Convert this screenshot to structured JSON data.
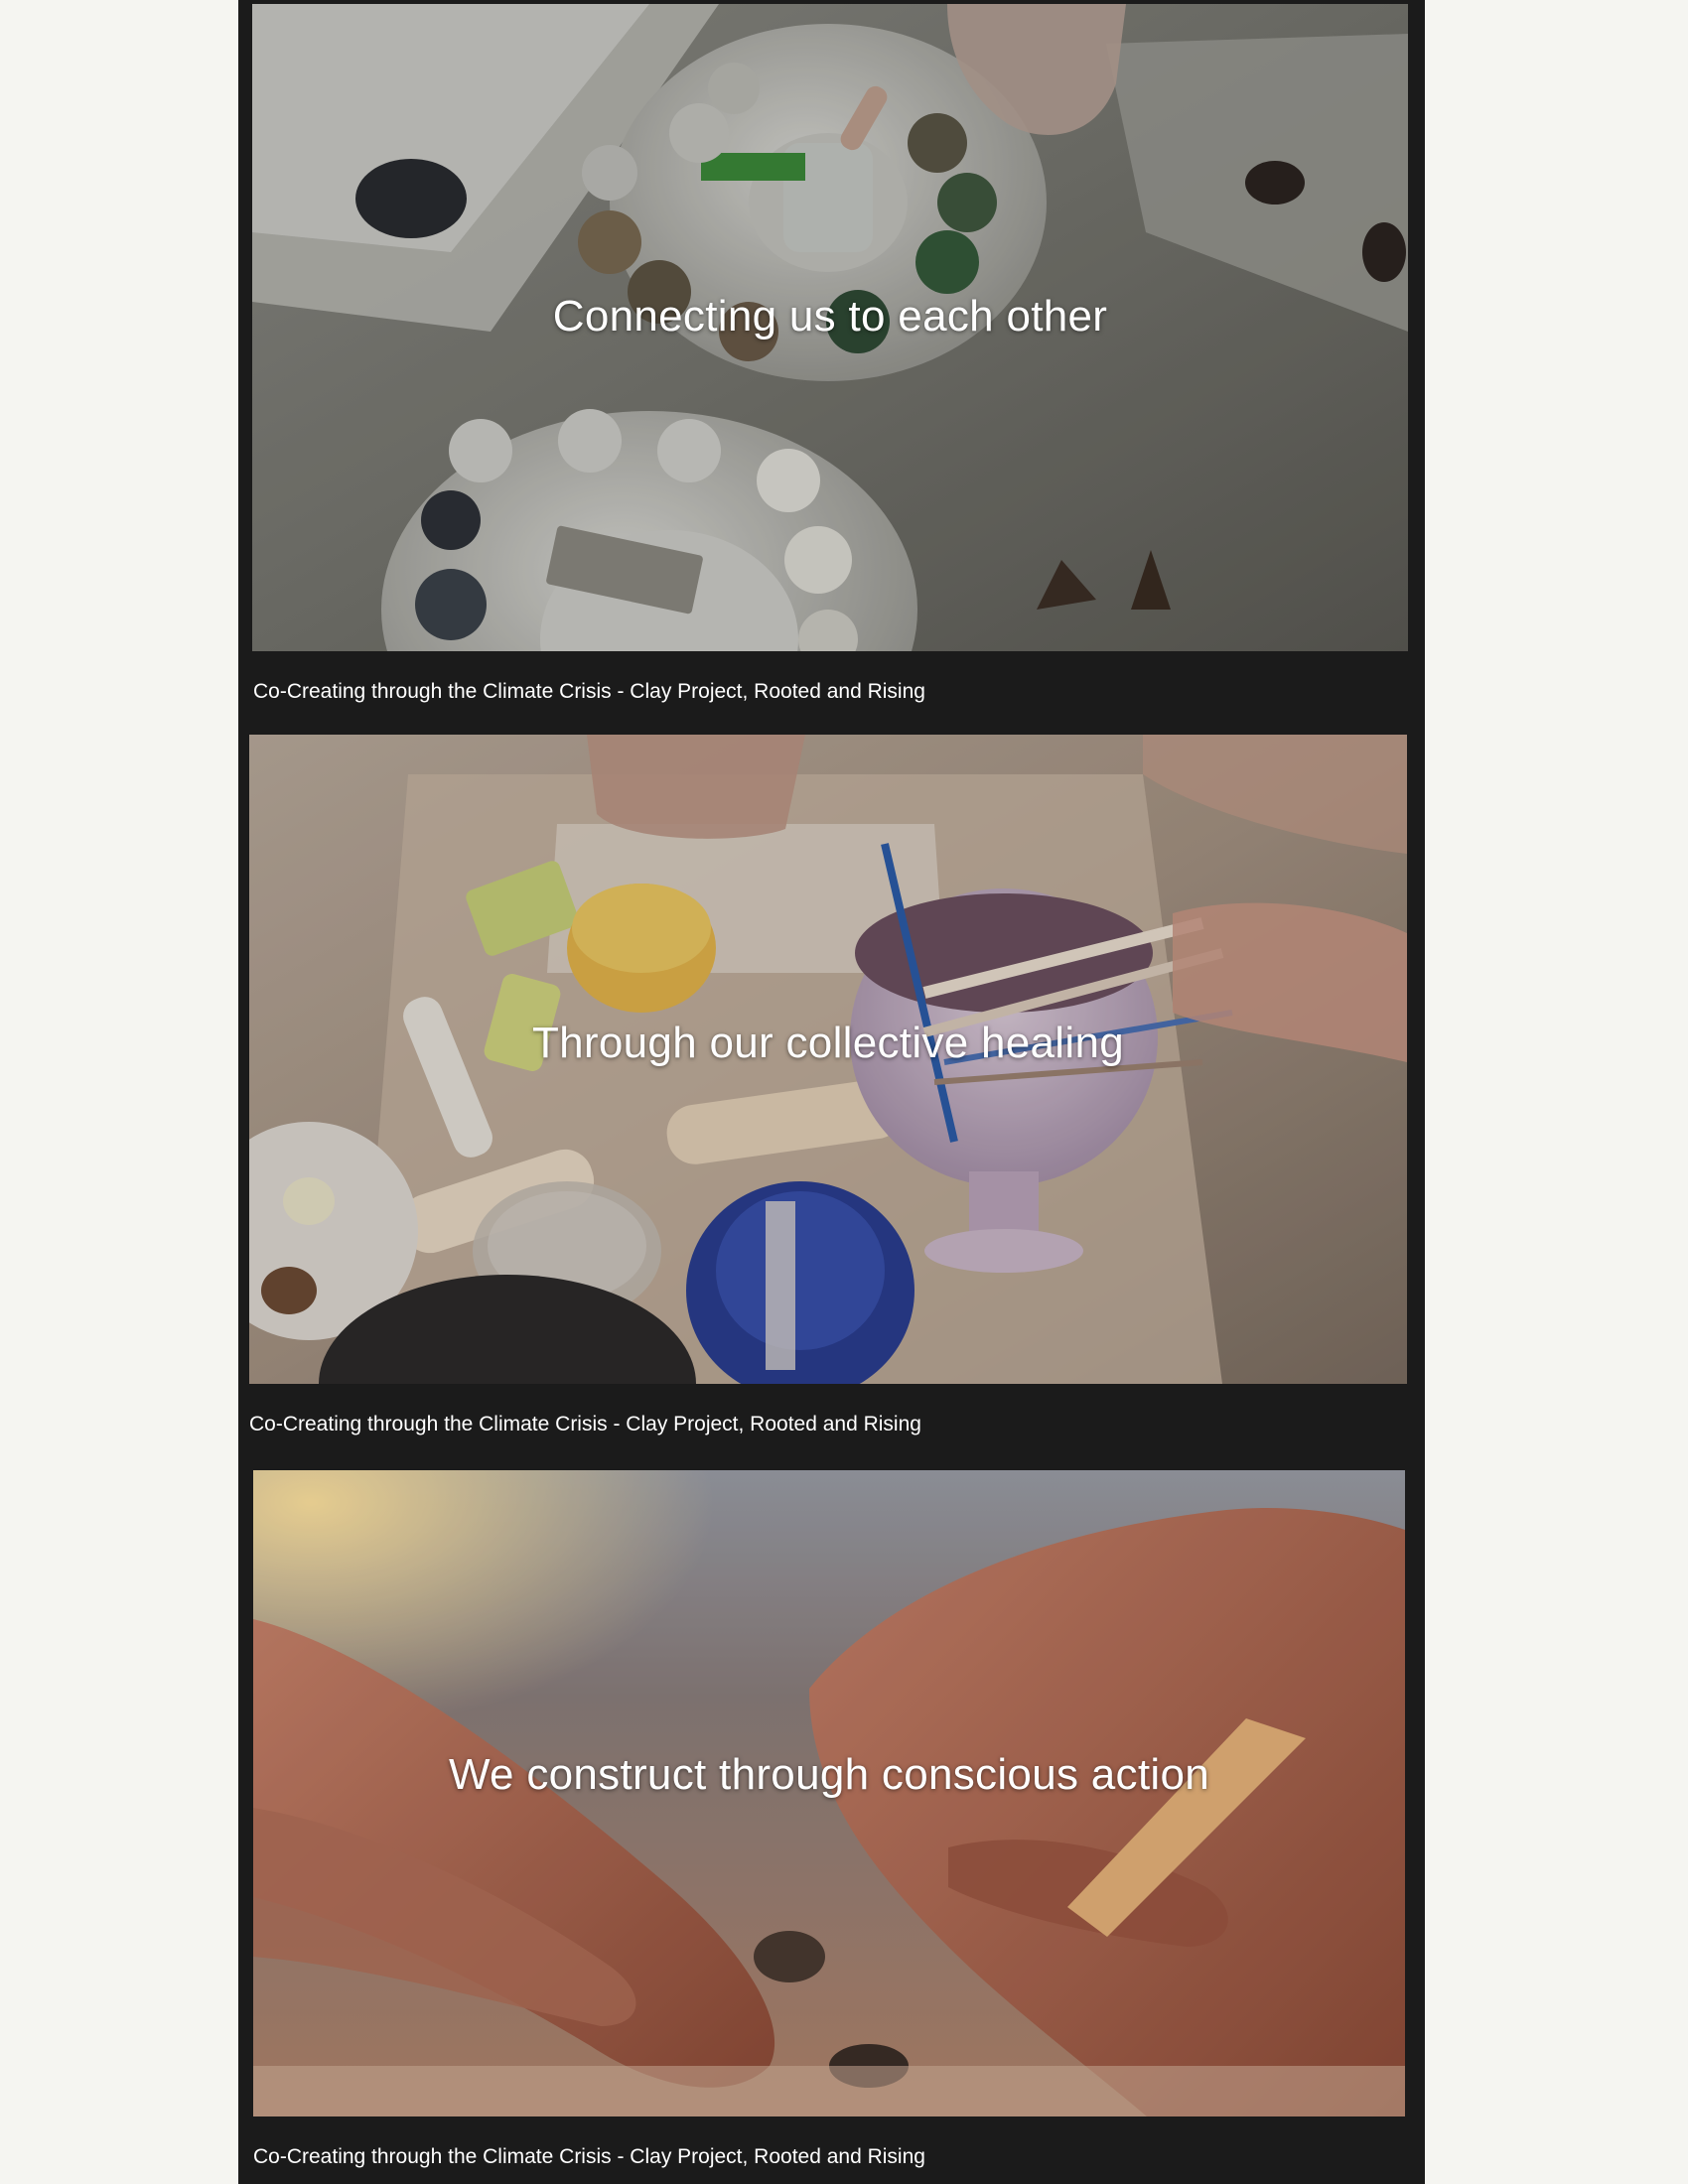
{
  "page": {
    "background_color": "#f5f5f1",
    "column_color": "#1b1b1b"
  },
  "videos": [
    {
      "overlay_text": "Connecting us to each other",
      "caption": "Co-Creating through the Climate Crisis - Clay Project, Rooted and Rising"
    },
    {
      "overlay_text": "Through our collective healing",
      "caption": "Co-Creating through the Climate Crisis - Clay Project, Rooted and Rising"
    },
    {
      "overlay_text": "We construct through conscious action",
      "caption": "Co-Creating through the Climate Crisis - Clay Project, Rooted and Rising"
    }
  ]
}
